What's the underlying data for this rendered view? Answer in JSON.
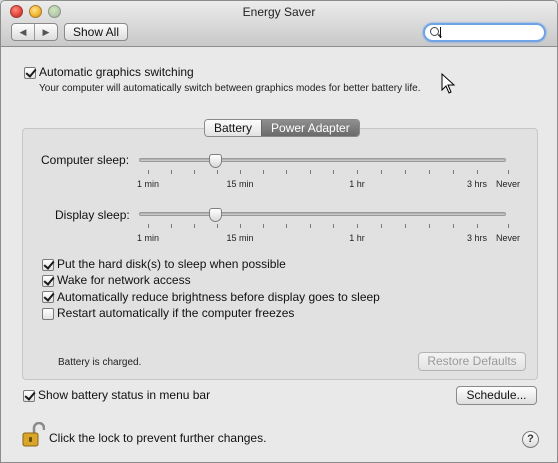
{
  "window": {
    "title": "Energy Saver",
    "nav_back": "◀",
    "nav_forward": "▶",
    "show_all_label": "Show All",
    "search_value": ""
  },
  "graphics": {
    "checkbox_label": "Automatic graphics switching",
    "checked": true,
    "description": "Your computer will automatically switch between graphics modes for better battery life."
  },
  "tabs": {
    "items": [
      {
        "label": "Battery",
        "active": false
      },
      {
        "label": "Power Adapter",
        "active": true
      }
    ]
  },
  "sliders": {
    "tick_labels": [
      "1 min",
      "15 min",
      "1 hr",
      "3 hrs",
      "Never"
    ],
    "computer_sleep": {
      "label": "Computer sleep:",
      "value": "15 min"
    },
    "display_sleep": {
      "label": "Display sleep:",
      "value": "15 min"
    }
  },
  "options": [
    {
      "label": "Put the hard disk(s) to sleep when possible",
      "checked": true
    },
    {
      "label": "Wake for network access",
      "checked": true
    },
    {
      "label": "Automatically reduce brightness before display goes to sleep",
      "checked": true
    },
    {
      "label": "Restart automatically if the computer freezes",
      "checked": false
    }
  ],
  "status": {
    "battery_text": "Battery is charged.",
    "restore_defaults_label": "Restore Defaults"
  },
  "footer": {
    "menu_bar_checkbox_label": "Show battery status in menu bar",
    "menu_bar_checked": true,
    "schedule_label": "Schedule...",
    "lock_text": "Click the lock to prevent further changes.",
    "help_label": "?"
  },
  "colors": {
    "window_bg": "#e9e9e9",
    "search_focus": "#6ea3e6",
    "active_tab": "#7a7a7a"
  }
}
